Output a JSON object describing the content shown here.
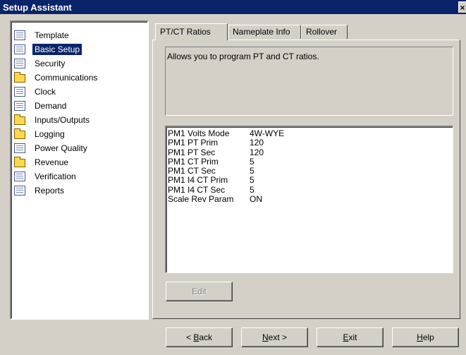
{
  "window": {
    "title": "Setup Assistant",
    "close_glyph": "×"
  },
  "tree": {
    "items": [
      {
        "label": "Template",
        "icon": "document-icon"
      },
      {
        "label": "Basic Setup",
        "icon": "document-icon",
        "selected": true
      },
      {
        "label": "Security",
        "icon": "document-icon"
      },
      {
        "label": "Communications",
        "icon": "folder-icon"
      },
      {
        "label": "Clock",
        "icon": "document-icon"
      },
      {
        "label": "Demand",
        "icon": "document-icon"
      },
      {
        "label": "Inputs/Outputs",
        "icon": "folder-icon"
      },
      {
        "label": "Logging",
        "icon": "folder-icon"
      },
      {
        "label": "Power Quality",
        "icon": "document-icon"
      },
      {
        "label": "Revenue",
        "icon": "folder-icon"
      },
      {
        "label": "Verification",
        "icon": "document-icon"
      },
      {
        "label": "Reports",
        "icon": "document-icon"
      }
    ]
  },
  "tabs": [
    {
      "label": "PT/CT Ratios",
      "active": true
    },
    {
      "label": "Nameplate Info",
      "active": false
    },
    {
      "label": "Rollover",
      "active": false
    }
  ],
  "description": "Allows you to program PT and CT ratios.",
  "parameters": [
    {
      "name": "PM1 Volts Mode",
      "value": "4W-WYE"
    },
    {
      "name": "PM1 PT Prim",
      "value": "120"
    },
    {
      "name": "PM1 PT Sec",
      "value": "120"
    },
    {
      "name": "PM1 CT Prim",
      "value": "5"
    },
    {
      "name": "PM1 CT Sec",
      "value": "5"
    },
    {
      "name": "PM1 I4 CT Prim",
      "value": "5"
    },
    {
      "name": "PM1 I4 CT Sec",
      "value": "5"
    },
    {
      "name": "Scale Rev Param",
      "value": "ON"
    }
  ],
  "buttons": {
    "edit": "Edit",
    "back": {
      "pre": "< ",
      "key": "B",
      "post": "ack"
    },
    "next": {
      "key": "N",
      "post": "ext >"
    },
    "exit": {
      "key": "E",
      "post": "xit"
    },
    "help": {
      "key": "H",
      "post": "elp"
    }
  }
}
